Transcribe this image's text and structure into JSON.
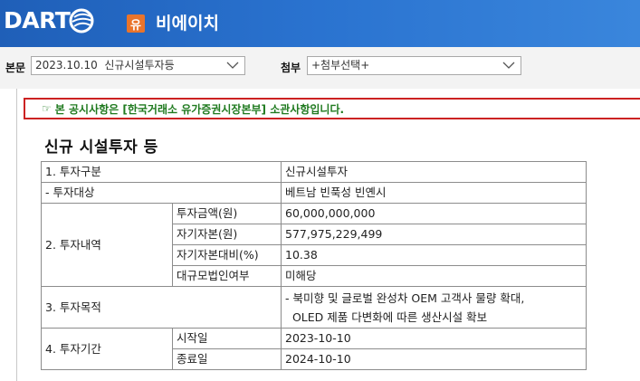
{
  "header": {
    "logo_text": "DART",
    "badge": "유",
    "company_name": "비에이치",
    "brand_color": "#1f5fb8"
  },
  "toolbar": {
    "main_label": "본문",
    "main_value": "2023.10.10  신규시설투자등",
    "attach_label": "첨부",
    "attach_value": "+첨부선택+"
  },
  "notice": {
    "icon": "pointing-hand-icon",
    "text": "본 공시사항은 [한국거래소 유가증권시장본부] 소관사항입니다."
  },
  "document": {
    "title": "신규 시설투자 등",
    "rows": {
      "type_label": "1. 투자구분",
      "type_value": "신규시설투자",
      "target_label": "- 투자대상",
      "target_value": "베트남 빈푹성 빈옌시",
      "details_label": "2. 투자내역",
      "amount_label": "투자금액(원)",
      "amount_value": "60,000,000,000",
      "equity_label": "자기자본(원)",
      "equity_value": "577,975,229,499",
      "ratio_label": "자기자본대비(%)",
      "ratio_value": "10.38",
      "large_corp_label": "대규모법인여부",
      "large_corp_value": "미해당",
      "purpose_label": "3. 투자목적",
      "purpose_line1": "- 북미향 및 글로벌 완성차 OEM 고객사 물량 확대,",
      "purpose_line2": "  OLED 제품 다변화에 따른 생산시설 확보",
      "period_label": "4. 투자기간",
      "start_label": "시작일",
      "start_value": "2023-10-10",
      "end_label": "종료일",
      "end_value": "2024-10-10"
    }
  }
}
